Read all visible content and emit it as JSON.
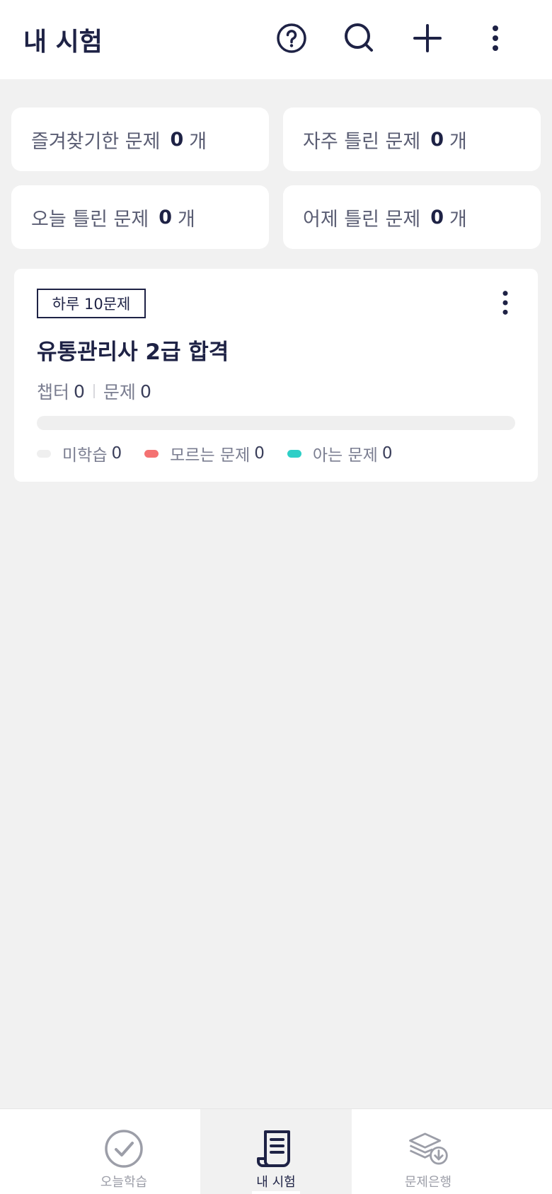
{
  "header": {
    "title": "내 시험",
    "icons": [
      "help-icon",
      "search-icon",
      "plus-icon",
      "more-vert-icon"
    ]
  },
  "stats": [
    {
      "label": "즐겨찾기한 문제",
      "count": "0",
      "unit": "개"
    },
    {
      "label": "자주 틀린 문제",
      "count": "0",
      "unit": "개"
    },
    {
      "label": "오늘 틀린 문제",
      "count": "0",
      "unit": "개"
    },
    {
      "label": "어제 틀린 문제",
      "count": "0",
      "unit": "개"
    }
  ],
  "exam": {
    "badge": "하루 10문제",
    "title": "유통관리사 2급 합격",
    "chapter_label": "챕터",
    "chapter_count": "0",
    "question_label": "문제",
    "question_count": "0",
    "progress": 0,
    "legend": [
      {
        "label": "미학습",
        "count": "0",
        "color": "#efefef"
      },
      {
        "label": "모르는 문제",
        "count": "0",
        "color": "#f47272"
      },
      {
        "label": "아는 문제",
        "count": "0",
        "color": "#2ecfc7"
      }
    ]
  },
  "bottom_nav": {
    "items": [
      {
        "label": "오늘학습",
        "icon": "check-circle-icon",
        "active": false
      },
      {
        "label": "내 시험",
        "icon": "document-scroll-icon",
        "active": true
      },
      {
        "label": "문제은행",
        "icon": "layers-download-icon",
        "active": false
      }
    ]
  },
  "colors": {
    "primary": "#1e2245",
    "background": "#f1f1f1",
    "wrong": "#f47272",
    "known": "#2ecfc7"
  }
}
